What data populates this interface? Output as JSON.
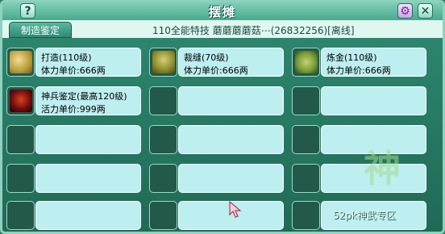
{
  "titlebar": {
    "title": "摆摊",
    "help_label": "?",
    "close_label": "✕"
  },
  "tabs": [
    {
      "label": "制造鉴定"
    }
  ],
  "shop": {
    "info": "110全能特技   蘑蘑蘑蘑菇⋯(26832256)[离线]"
  },
  "skills": [
    {
      "name": "打造(110级)",
      "cost": "体力单价:666两",
      "icon": "hammer-icon"
    },
    {
      "name": "裁缝(70级)",
      "cost": "体力单价:666两",
      "icon": "needle-icon"
    },
    {
      "name": "炼金(110级)",
      "cost": "体力单价:666两",
      "icon": "alchemy-icon"
    },
    {
      "name": "神兵鉴定(最高120级)",
      "cost": "活力单价:999两",
      "icon": "weapon-appraisal-icon"
    }
  ],
  "watermark": {
    "big": "神",
    "small": "52pk神武专区"
  },
  "colors": {
    "frame": "#2f8a72",
    "slot": "#bdeef0",
    "icon_slot": "#22594a"
  }
}
